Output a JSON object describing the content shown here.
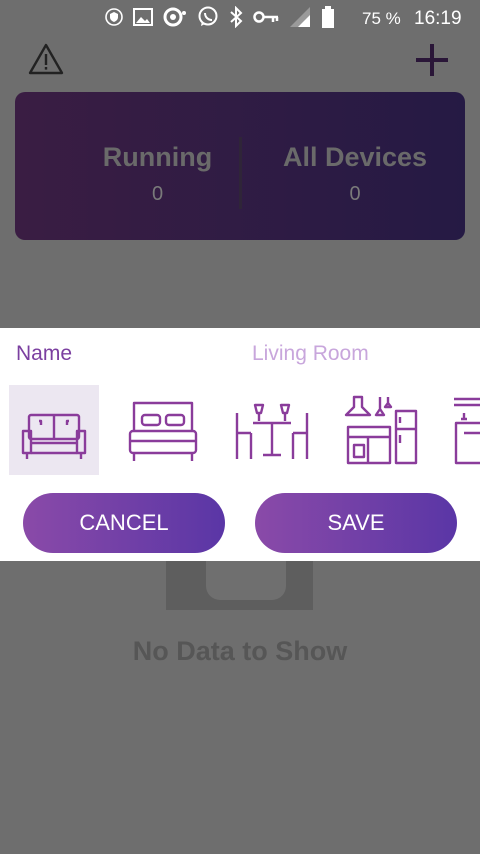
{
  "status_bar": {
    "icons": [
      "shield-icon",
      "image-icon",
      "sync-icon",
      "whatsapp-icon",
      "bluetooth-icon",
      "key-icon",
      "signal-icon",
      "battery-icon"
    ],
    "battery_text": "75 %",
    "time": "16:19"
  },
  "app_bar": {
    "icons": [
      "warning-icon",
      "add-icon"
    ]
  },
  "stats": {
    "running_label": "Running",
    "running_value": "0",
    "all_label": "All Devices",
    "all_value": "0"
  },
  "empty_state": {
    "text": "No Data to Show"
  },
  "dialog": {
    "name_label": "Name",
    "name_value": "Living Room",
    "room_icons": [
      "sofa-icon",
      "bed-icon",
      "dining-table-icon",
      "kitchen-icon",
      "room-icon"
    ],
    "selected_room": "sofa-icon",
    "cancel_label": "CANCEL",
    "save_label": "SAVE"
  },
  "colors": {
    "accent": "#7b3fa0",
    "card_start": "#3a1d43",
    "card_end": "#251a44",
    "button_start": "#8a4aa8",
    "button_end": "#5a36a6"
  }
}
